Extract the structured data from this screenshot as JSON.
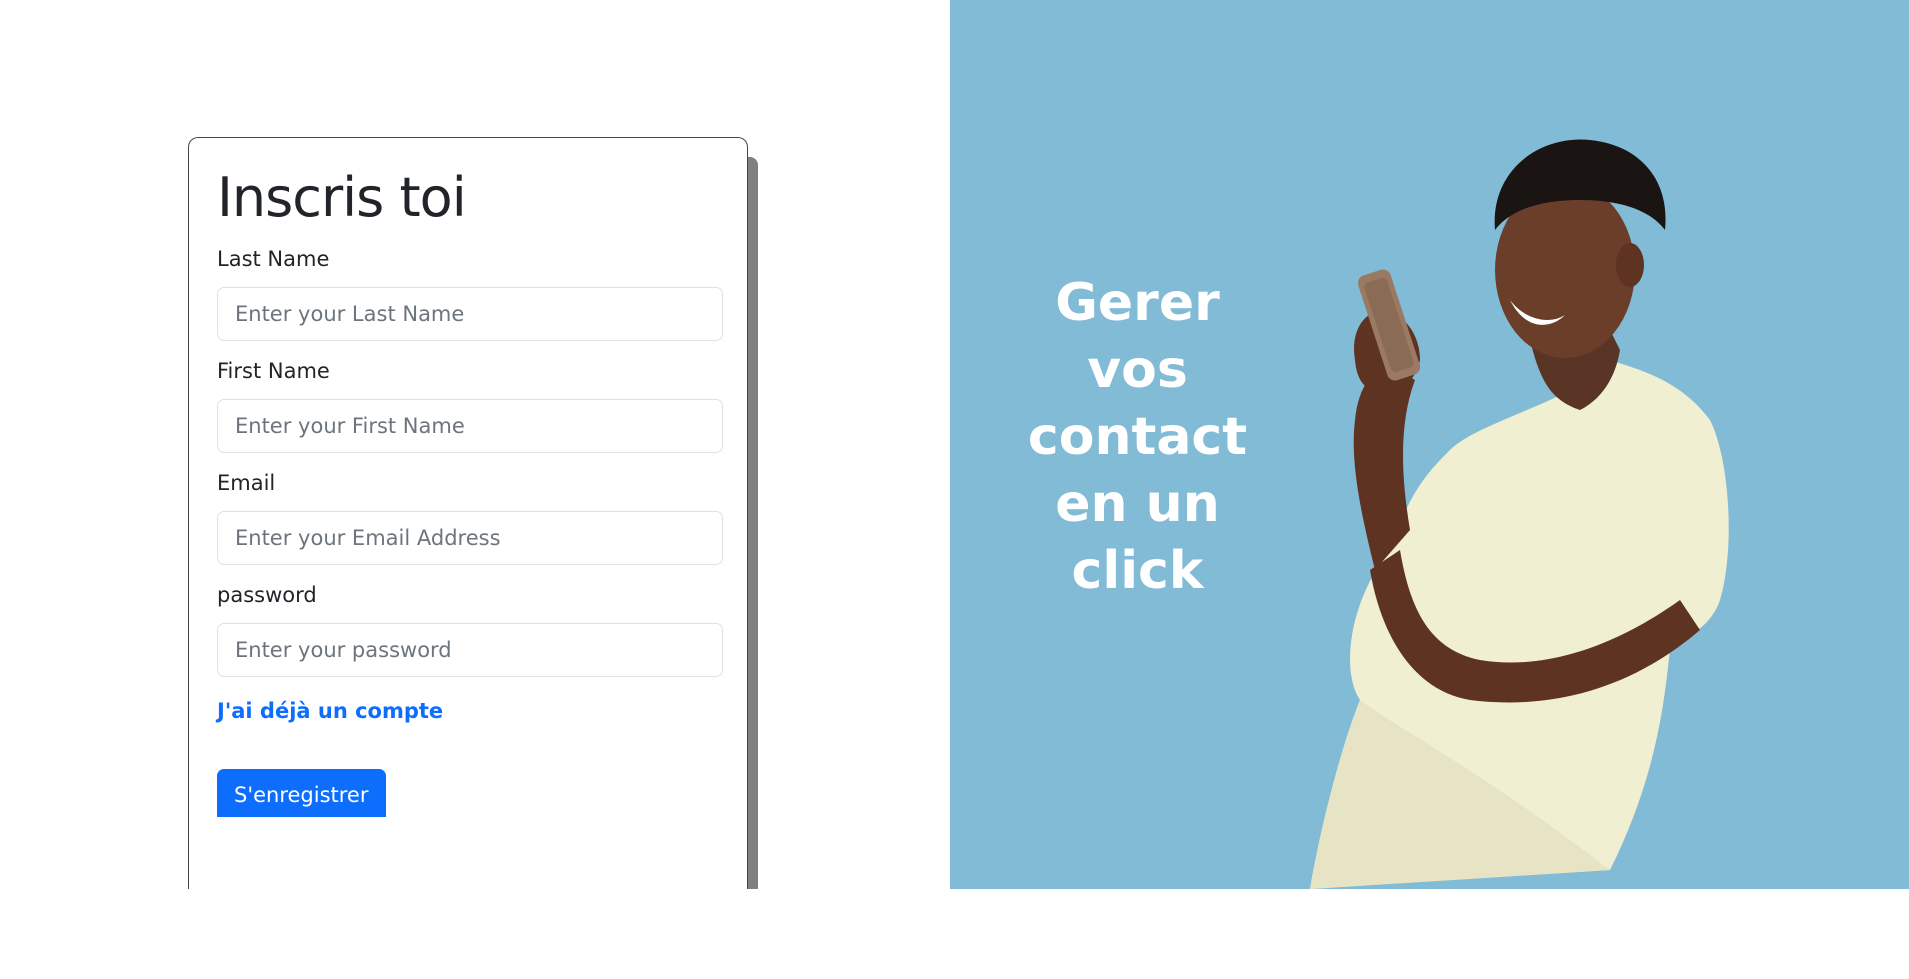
{
  "form": {
    "title": "Inscris toi",
    "fields": [
      {
        "label": "Last Name",
        "placeholder": "Enter your Last Name",
        "value": ""
      },
      {
        "label": "First Name",
        "placeholder": "Enter your First Name",
        "value": ""
      },
      {
        "label": "Email",
        "placeholder": "Enter your Email Address",
        "value": ""
      },
      {
        "label": "password",
        "placeholder": "Enter your password",
        "value": ""
      }
    ],
    "login_link": "J'ai déjà un compte",
    "submit_label": "S'enregistrer"
  },
  "hero": {
    "lines": [
      "Gerer",
      "vos",
      "contact",
      "en un",
      "click"
    ],
    "background_color": "#82bbd6",
    "image": "man-with-phone-photo"
  },
  "colors": {
    "primary": "#0d6efd",
    "text": "#212529",
    "placeholder": "#6c757d"
  }
}
